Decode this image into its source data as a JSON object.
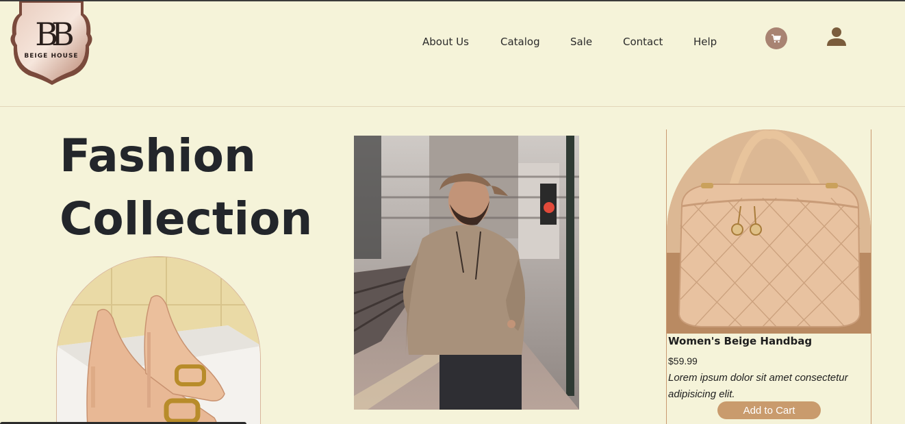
{
  "brand": {
    "monogram": "BB",
    "name": "BEIGE HOUSE"
  },
  "nav": {
    "items": [
      {
        "label": "About Us"
      },
      {
        "label": "Catalog"
      },
      {
        "label": "Sale"
      },
      {
        "label": "Contact"
      },
      {
        "label": "Help"
      }
    ],
    "cart_icon": "cart-icon",
    "user_icon": "user-icon"
  },
  "hero": {
    "title_line1": "Fashion",
    "title_line2": "Collection"
  },
  "product": {
    "name": "Women's Beige Handbag",
    "price": "$59.99",
    "description": "Lorem ipsum dolor sit amet consectetur adipisicing elit.",
    "button_label": "Add to Cart"
  },
  "colors": {
    "background": "#f5f3d9",
    "accent": "#c99b6d",
    "cart_circle": "#a88372",
    "user_icon": "#7a5c3c"
  }
}
